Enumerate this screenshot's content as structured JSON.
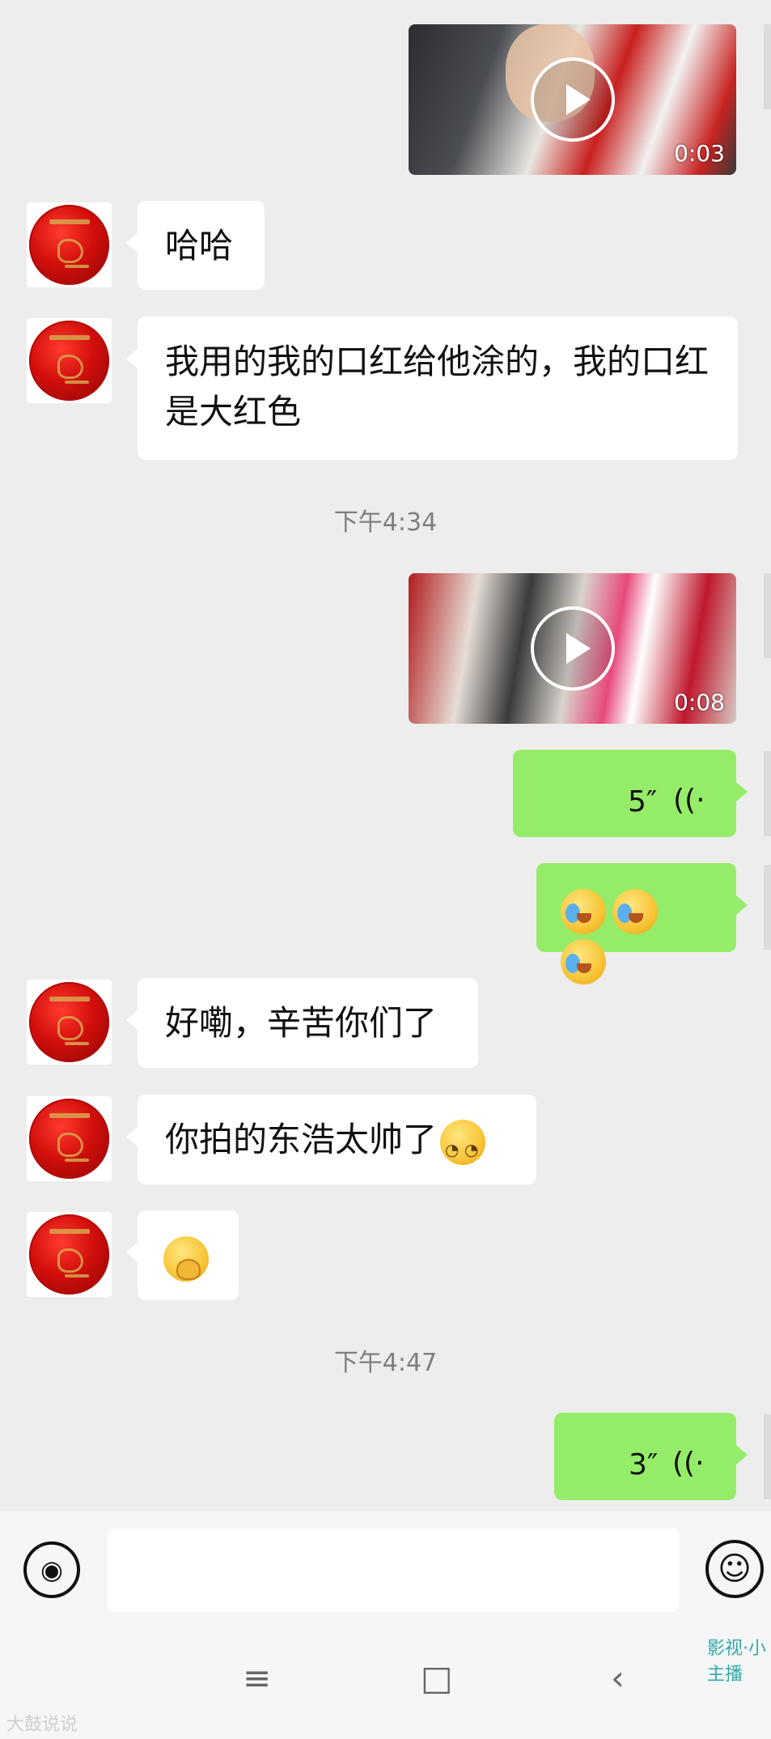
{
  "messages": {
    "video1_duration": "0:03",
    "msg_haha": "哈哈",
    "msg_lipstick": "我用的我的口红给他涂的，我的口红是大红色",
    "time1": "下午4:34",
    "video2_duration": "0:08",
    "voice1_length": "5″",
    "voice_icon": "((·",
    "msg_good": "好嘞，辛苦你们了",
    "msg_handsome": "你拍的东浩太帅了",
    "time2": "下午4:47",
    "voice2_length": "3″"
  },
  "emojis": {
    "facepalm": "facepalm-cry-emoji",
    "smirk": "smirk-emoji",
    "hand_over_mouth": "hand-over-mouth-emoji"
  },
  "input": {
    "voice_glyph": "◉",
    "emoji_glyph": "☺"
  },
  "navbar": {
    "menu": "≡",
    "home": "□",
    "back": "‹"
  },
  "watermark": {
    "left": "大鼓说说",
    "right": "影视·小主播"
  },
  "colors": {
    "green_bubble": "#95ec69",
    "background": "#ededed"
  }
}
